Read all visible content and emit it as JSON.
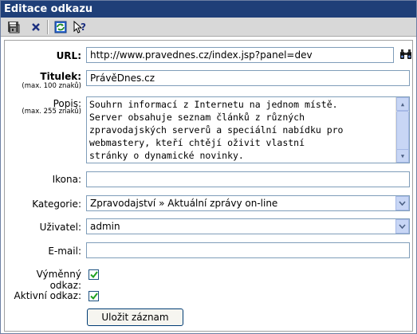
{
  "window": {
    "title": "Editace odkazu"
  },
  "toolbar": {
    "icons": [
      "save-icon",
      "delete-icon",
      "refresh-icon",
      "help-icon"
    ]
  },
  "form": {
    "url": {
      "label": "URL:",
      "value": "http://www.pravednes.cz/index.jsp?panel=dev"
    },
    "title": {
      "label": "Titulek:",
      "hint": "(max. 100 znaků)",
      "value": "PrávěDnes.cz"
    },
    "description": {
      "label": "Popis:",
      "hint": "(max. 255 znaků)",
      "lines": [
        "Souhrn informací z Internetu na jednom místě.",
        "Server obsahuje seznam článků z různých",
        "zpravodajských serverů a speciální nabídku pro",
        "webmastery, kteří chtějí oživit vlastní",
        "stránky o dynamické novinky."
      ]
    },
    "icon": {
      "label": "Ikona:",
      "value": ""
    },
    "category": {
      "label": "Kategorie:",
      "value": "Zpravodajství » Aktuální zprávy on-line"
    },
    "user": {
      "label": "Uživatel:",
      "value": "admin"
    },
    "email": {
      "label": "E-mail:",
      "value": ""
    },
    "exchange": {
      "label": "Výměnný odkaz:",
      "checked": true
    },
    "active": {
      "label": "Aktivní odkaz:",
      "checked": true
    },
    "save_label": "Uložit záznam"
  },
  "colors": {
    "titlebar": "#1f3f78",
    "toolbar": "#d8d8d8",
    "input_border": "#7f9db9",
    "checkmark": "#21a121"
  }
}
